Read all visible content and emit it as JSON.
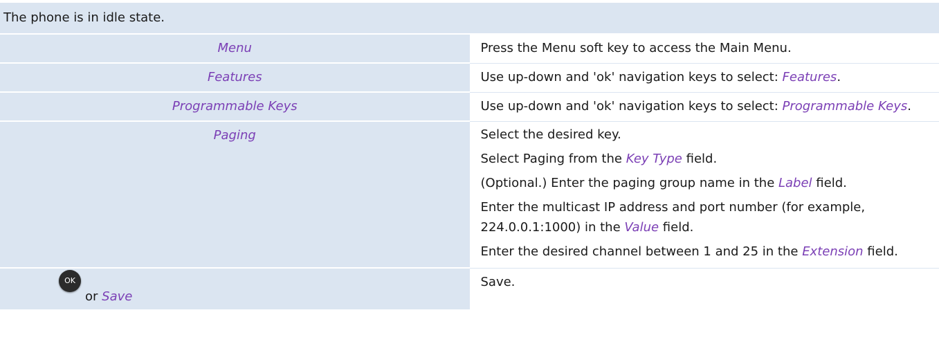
{
  "intro": "The phone is in idle state.",
  "steps": [
    {
      "key": "Menu",
      "desc": "Press the Menu soft key to access the Main Menu."
    },
    {
      "key": "Features",
      "desc_prefix": "Use up-down and 'ok' navigation keys to select: ",
      "desc_accent": "Features",
      "desc_suffix": "."
    },
    {
      "key": "Programmable Keys",
      "desc_prefix": "Use up-down and 'ok' navigation keys to select: ",
      "desc_accent": "Programmable Keys",
      "desc_suffix": "."
    }
  ],
  "paging": {
    "key": "Paging",
    "p1": "Select the desired key.",
    "p2_prefix": "Select Paging from the ",
    "p2_accent": "Key Type",
    "p2_suffix": " field.",
    "p3_prefix": "(Optional.) Enter the paging group name in the ",
    "p3_accent": "Label",
    "p3_suffix": " field.",
    "p4_prefix": "Enter the multicast IP address and port number (for example, 224.0.0.1:1000) in the ",
    "p4_accent": "Value",
    "p4_suffix": " field.",
    "p5_prefix": "Enter the desired channel between 1 and 25 in the ",
    "p5_accent": "Extension",
    "p5_suffix": " field."
  },
  "save": {
    "ok_label": "OK",
    "or": "or ",
    "key": "Save",
    "desc": "Save."
  },
  "icons": {
    "ok_button": "ok-key-icon"
  },
  "colors": {
    "accent": "#7b3fb5",
    "row_bg": "#dbe5f1"
  }
}
